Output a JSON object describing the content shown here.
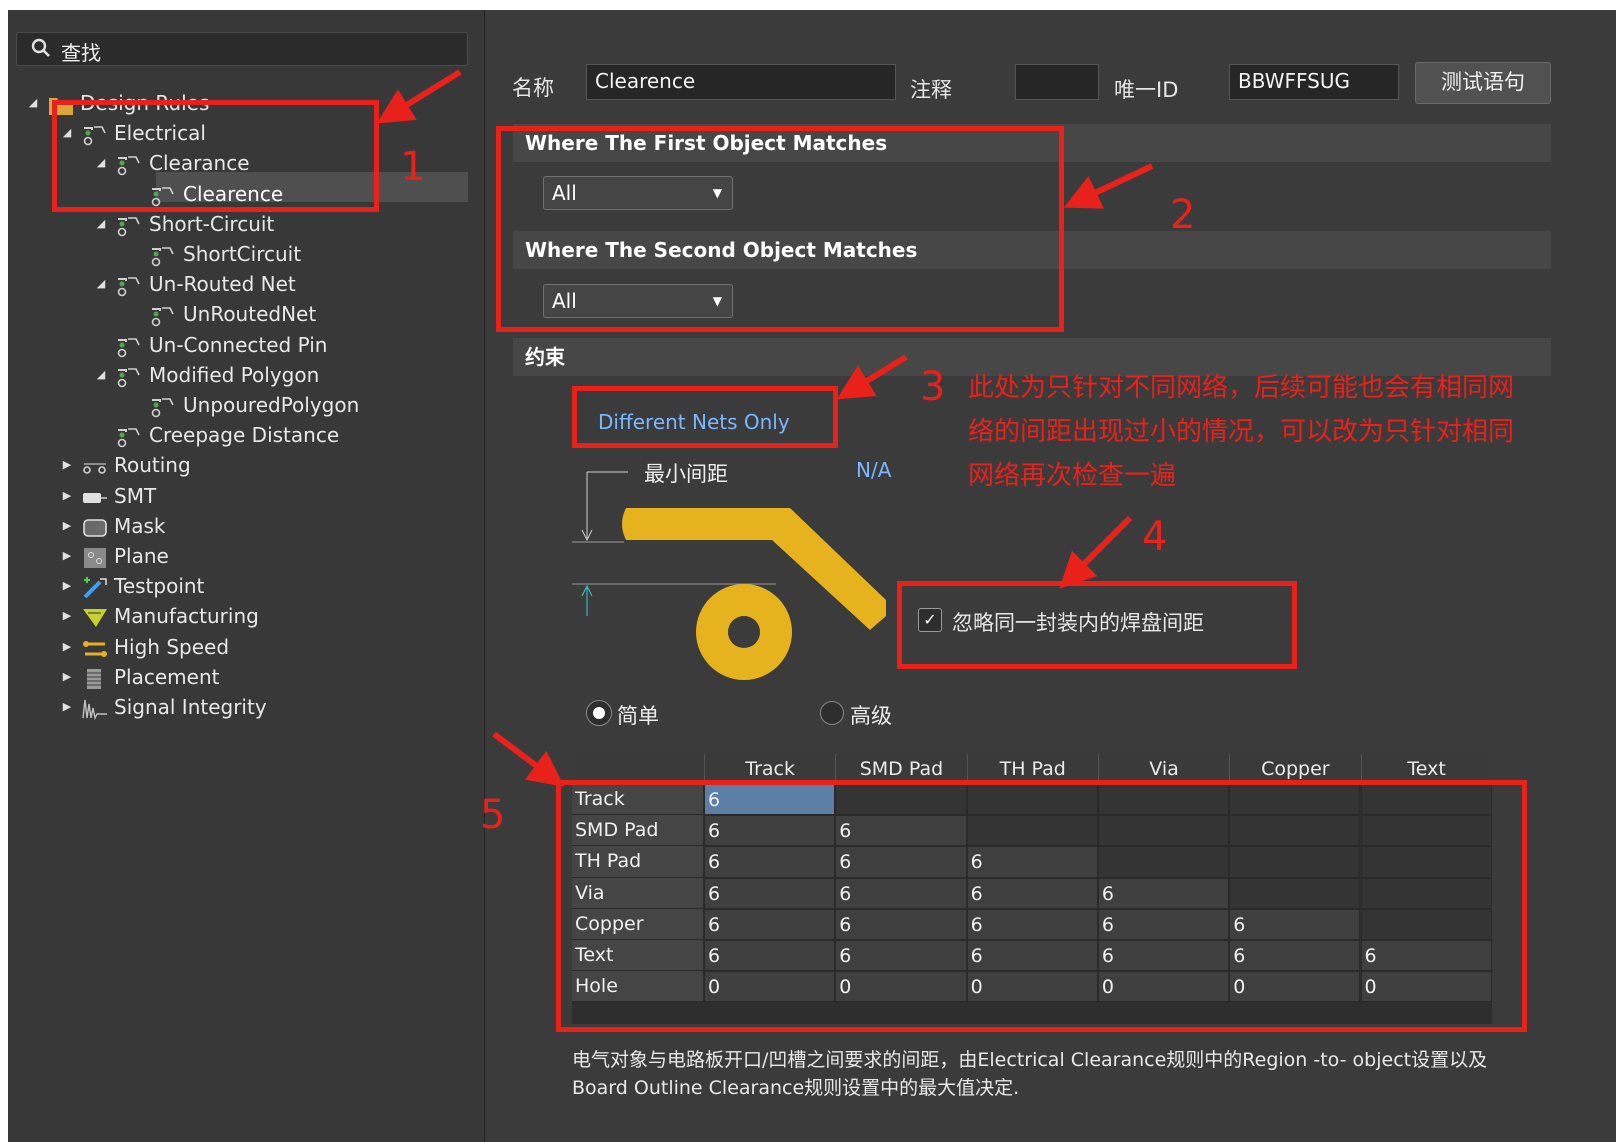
{
  "search": {
    "icon": "search-icon",
    "text": "查找"
  },
  "tree": [
    {
      "label": "Design Rules",
      "icon": "folder-rules-icon",
      "expanded": true,
      "depth": 0
    },
    {
      "label": "Electrical",
      "icon": "rule-icon",
      "expanded": true,
      "depth": 1
    },
    {
      "label": "Clearance",
      "icon": "rule-icon",
      "expanded": true,
      "depth": 2
    },
    {
      "label": "Clearence",
      "icon": "rule-icon",
      "depth": 3,
      "selected": true
    },
    {
      "label": "Short-Circuit",
      "icon": "rule-icon",
      "expanded": true,
      "depth": 2
    },
    {
      "label": "ShortCircuit",
      "icon": "rule-icon",
      "depth": 3
    },
    {
      "label": "Un-Routed Net",
      "icon": "rule-icon",
      "expanded": true,
      "depth": 2
    },
    {
      "label": "UnRoutedNet",
      "icon": "rule-icon",
      "depth": 3
    },
    {
      "label": "Un-Connected Pin",
      "icon": "rule-icon",
      "depth": 2
    },
    {
      "label": "Modified Polygon",
      "icon": "rule-icon",
      "expanded": true,
      "depth": 2
    },
    {
      "label": "UnpouredPolygon",
      "icon": "rule-icon",
      "depth": 3
    },
    {
      "label": "Creepage Distance",
      "icon": "rule-icon",
      "depth": 2
    },
    {
      "label": "Routing",
      "icon": "routing-icon",
      "expanded": false,
      "depth": 1
    },
    {
      "label": "SMT",
      "icon": "smt-icon",
      "expanded": false,
      "depth": 1
    },
    {
      "label": "Mask",
      "icon": "mask-icon",
      "expanded": false,
      "depth": 1
    },
    {
      "label": "Plane",
      "icon": "plane-icon",
      "expanded": false,
      "depth": 1
    },
    {
      "label": "Testpoint",
      "icon": "testpoint-icon",
      "expanded": false,
      "depth": 1
    },
    {
      "label": "Manufacturing",
      "icon": "manufacturing-icon",
      "expanded": false,
      "depth": 1
    },
    {
      "label": "High Speed",
      "icon": "high-speed-icon",
      "expanded": false,
      "depth": 1
    },
    {
      "label": "Placement",
      "icon": "placement-icon",
      "expanded": false,
      "depth": 1
    },
    {
      "label": "Signal Integrity",
      "icon": "signal-integrity-icon",
      "expanded": false,
      "depth": 1
    }
  ],
  "header": {
    "name_label": "名称",
    "name_value": "Clearence",
    "comment_label": "注释",
    "comment_value": "",
    "uid_label": "唯一ID",
    "uid_value": "BBWFFSUG",
    "test_button": "测试语句"
  },
  "first_match": {
    "title": "Where The First Object Matches",
    "value": "All"
  },
  "second_match": {
    "title": "Where The Second Object Matches",
    "value": "All"
  },
  "constraints": {
    "title": "约束",
    "net_scope": "Different Nets Only",
    "min_gap_label": "最小间距",
    "min_gap_value": "N/A",
    "ignore_pads_label": "忽略同一封装内的焊盘间距",
    "ignore_pads_checked": true,
    "mode_simple": "简单",
    "mode_advanced": "高级",
    "mode_selected": "simple",
    "pad_color": "#e6b21e"
  },
  "table": {
    "columns": [
      "Track",
      "SMD Pad",
      "TH Pad",
      "Via",
      "Copper",
      "Text"
    ],
    "rows": [
      {
        "name": "Track",
        "values": [
          "6",
          "",
          "",
          "",
          "",
          ""
        ]
      },
      {
        "name": "SMD Pad",
        "values": [
          "6",
          "6",
          "",
          "",
          "",
          ""
        ]
      },
      {
        "name": "TH Pad",
        "values": [
          "6",
          "6",
          "6",
          "",
          "",
          ""
        ]
      },
      {
        "name": "Via",
        "values": [
          "6",
          "6",
          "6",
          "6",
          "",
          ""
        ]
      },
      {
        "name": "Copper",
        "values": [
          "6",
          "6",
          "6",
          "6",
          "6",
          ""
        ]
      },
      {
        "name": "Text",
        "values": [
          "6",
          "6",
          "6",
          "6",
          "6",
          "6"
        ]
      },
      {
        "name": "Hole",
        "values": [
          "0",
          "0",
          "0",
          "0",
          "0",
          "0"
        ]
      }
    ]
  },
  "bottom_note": "电气对象与电路板开口/凹槽之间要求的间距，由Electrical Clearance规则中的Region -to- object设置以及Board Outline Clearance规则设置中的最大值决定.",
  "annotations": {
    "color": "#e8211b",
    "n1": "1",
    "n2": "2",
    "n3": "3",
    "n4": "4",
    "n5": "5",
    "note": "此处为只针对不同网络，后续可能也会有相同网络的间距出现过小的情况，可以改为只针对相同网络再次检查一遍"
  }
}
